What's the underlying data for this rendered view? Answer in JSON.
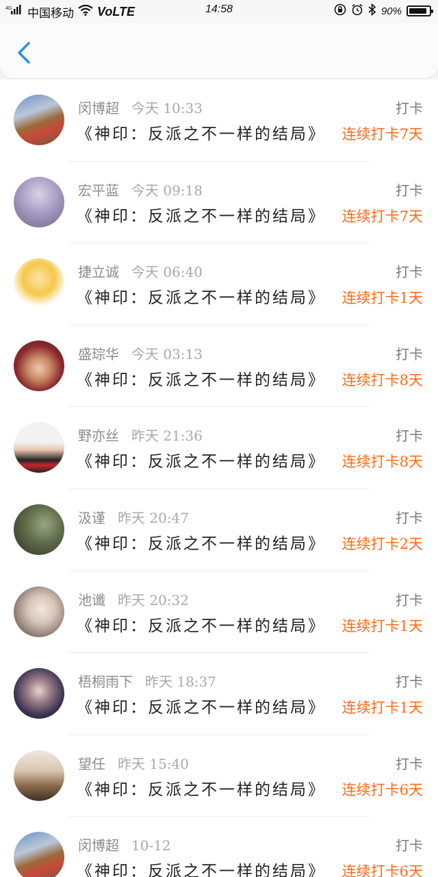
{
  "status_bar": {
    "network": "4G",
    "carrier": "中国移动",
    "volte": "VoLTE",
    "time": "14:58",
    "battery": "90%",
    "battery_level": 0.9
  },
  "navbar": {
    "back_icon": "chevron-left-icon"
  },
  "entries": [
    {
      "name": "闵博超",
      "time": "今天 10:33",
      "action": "打卡",
      "book": "《神印：反派之不一样的结局》",
      "streak": "连续打卡7天"
    },
    {
      "name": "宏平蓝",
      "time": "今天 09:18",
      "action": "打卡",
      "book": "《神印：反派之不一样的结局》",
      "streak": "连续打卡7天"
    },
    {
      "name": "捷立诚",
      "time": "今天 06:40",
      "action": "打卡",
      "book": "《神印：反派之不一样的结局》",
      "streak": "连续打卡1天"
    },
    {
      "name": "盛琮华",
      "time": "今天 03:13",
      "action": "打卡",
      "book": "《神印：反派之不一样的结局》",
      "streak": "连续打卡8天"
    },
    {
      "name": "野亦丝",
      "time": "昨天 21:36",
      "action": "打卡",
      "book": "《神印：反派之不一样的结局》",
      "streak": "连续打卡8天"
    },
    {
      "name": "汲谨",
      "time": "昨天 20:47",
      "action": "打卡",
      "book": "《神印：反派之不一样的结局》",
      "streak": "连续打卡2天"
    },
    {
      "name": "池谶",
      "time": "昨天 20:32",
      "action": "打卡",
      "book": "《神印：反派之不一样的结局》",
      "streak": "连续打卡1天"
    },
    {
      "name": "梧桐雨下",
      "time": "昨天 18:37",
      "action": "打卡",
      "book": "《神印：反派之不一样的结局》",
      "streak": "连续打卡1天"
    },
    {
      "name": "望任",
      "time": "昨天 15:40",
      "action": "打卡",
      "book": "《神印：反派之不一样的结局》",
      "streak": "连续打卡6天"
    },
    {
      "name": "闵博超",
      "time": "10-12",
      "action": "打卡",
      "book": "《神印：反派之不一样的结局》",
      "streak": "连续打卡6天"
    }
  ],
  "colors": {
    "accent": "#ff6a1a",
    "back": "#2a8cf0"
  }
}
